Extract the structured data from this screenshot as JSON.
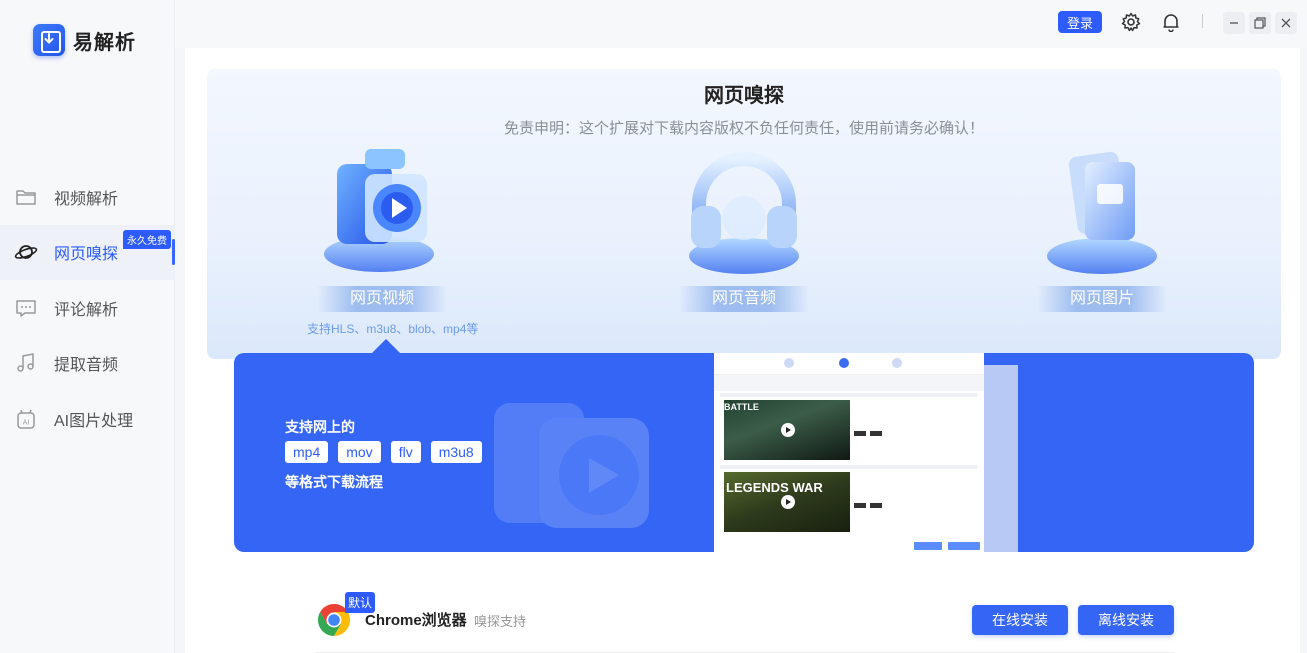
{
  "app": {
    "name": "易解析"
  },
  "sidebar": {
    "items": [
      {
        "label": "视频解析",
        "icon": "folder-icon"
      },
      {
        "label": "网页嗅探",
        "icon": "planet-icon",
        "badge": "永久免费",
        "active": true
      },
      {
        "label": "评论解析",
        "icon": "comment-icon"
      },
      {
        "label": "提取音频",
        "icon": "music-icon"
      },
      {
        "label": "AI图片处理",
        "icon": "ai-image-icon"
      }
    ]
  },
  "topbar": {
    "login_label": "登录",
    "icons": [
      "gear-icon",
      "bell-icon",
      "minimize-icon",
      "restore-icon",
      "close-icon"
    ]
  },
  "hero": {
    "title": "网页嗅探",
    "subtitle": "免责申明：这个扩展对下载内容版权不负任何责任，使用前请务必确认！",
    "features": [
      {
        "label": "网页视频",
        "desc": "支持HLS、m3u8、blob、mp4等"
      },
      {
        "label": "网页音频",
        "desc": ""
      },
      {
        "label": "网页图片",
        "desc": ""
      }
    ]
  },
  "banner": {
    "line1": "支持网上的",
    "formats": [
      "mp4",
      "mov",
      "flv",
      "m3u8"
    ],
    "line2": "等格式下载流程",
    "preview": {
      "thumb1_title": "BATTLE",
      "thumb2_title": "LEGENDS WAR"
    }
  },
  "browser": {
    "default_tag": "默认",
    "name": "Chrome浏览器",
    "note": "嗅探支持",
    "online_install": "在线安装",
    "offline_install": "离线安装"
  },
  "colors": {
    "accent": "#3565f5",
    "active_text": "#2a5bff"
  }
}
